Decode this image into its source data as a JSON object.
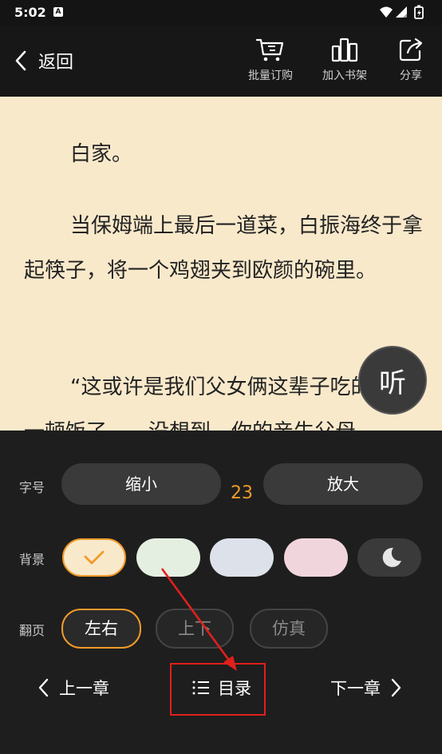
{
  "status_bar": {
    "time": "5:02",
    "notif_icon_letter": "A"
  },
  "top_bar": {
    "back_label": "返回",
    "actions": [
      {
        "label": "批量订购",
        "icon": "cart-icon"
      },
      {
        "label": "加入书架",
        "icon": "bookshelf-icon"
      },
      {
        "label": "分享",
        "icon": "share-icon"
      }
    ]
  },
  "reading": {
    "paragraphs": [
      "白家。",
      "当保姆端上最后一道菜，白振海终于拿起筷子，将一个鸡翅夹到欧颜的碗里。",
      "“这或许是我们父女俩这辈子吃的最后一顿饭了……没想到，你的亲生父母"
    ],
    "listen_label": "听"
  },
  "settings": {
    "font_size": {
      "label": "字号",
      "decrease": "缩小",
      "value": "23",
      "increase": "放大"
    },
    "background": {
      "label": "背景",
      "options": [
        {
          "name": "cream",
          "color": "#f9e9cb",
          "selected": true
        },
        {
          "name": "green",
          "color": "#e4efe1",
          "selected": false
        },
        {
          "name": "blue",
          "color": "#dde1ea",
          "selected": false
        },
        {
          "name": "pink",
          "color": "#f0d6dc",
          "selected": false
        },
        {
          "name": "night",
          "color": "#3a3a3a",
          "selected": false
        }
      ]
    },
    "page_turn": {
      "label": "翻页",
      "options": [
        {
          "label": "左右",
          "selected": true
        },
        {
          "label": "上下",
          "selected": false
        },
        {
          "label": "仿真",
          "selected": false
        }
      ]
    },
    "nav": {
      "prev": "上一章",
      "toc": "目录",
      "next": "下一章"
    }
  },
  "colors": {
    "accent": "#f09a2a",
    "annotation": "#e0201c"
  }
}
